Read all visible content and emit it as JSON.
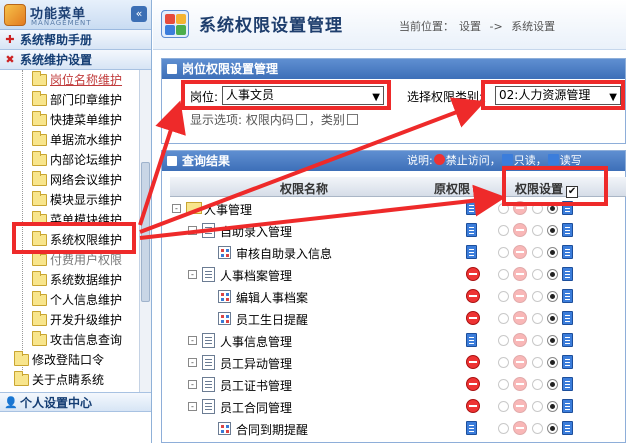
{
  "sidebar": {
    "title": "功能菜单",
    "subtitle": "MANAGEMENT",
    "collapse_label": "«",
    "section_help": "系统帮助手册",
    "section_maint": "系统维护设置",
    "items": [
      {
        "label": "岗位名称维护",
        "indent": 1,
        "state": "active"
      },
      {
        "label": "部门印章维护",
        "indent": 1,
        "state": "normal"
      },
      {
        "label": "快捷菜单维护",
        "indent": 1,
        "state": "normal"
      },
      {
        "label": "单据流水维护",
        "indent": 1,
        "state": "normal"
      },
      {
        "label": "内部论坛维护",
        "indent": 1,
        "state": "normal"
      },
      {
        "label": "网络会议维护",
        "indent": 1,
        "state": "normal"
      },
      {
        "label": "模块显示维护",
        "indent": 1,
        "state": "normal"
      },
      {
        "label": "菜单模块维护",
        "indent": 1,
        "state": "normal"
      },
      {
        "label": "系统权限维护",
        "indent": 1,
        "state": "normal"
      },
      {
        "label": "付费用户权限",
        "indent": 1,
        "state": "dim"
      },
      {
        "label": "系统数据维护",
        "indent": 1,
        "state": "normal"
      },
      {
        "label": "个人信息维护",
        "indent": 1,
        "state": "normal"
      },
      {
        "label": "开发升级维护",
        "indent": 1,
        "state": "normal"
      },
      {
        "label": "攻击信息查询",
        "indent": 1,
        "state": "normal"
      },
      {
        "label": "修改登陆口令",
        "indent": 0,
        "state": "normal"
      },
      {
        "label": "关于点睛系统",
        "indent": 0,
        "state": "normal"
      }
    ],
    "section_personal": "个人设置中心"
  },
  "header": {
    "title": "系统权限设置管理",
    "crumb_prefix": "当前位置：",
    "crumb_1": "设置",
    "crumb_sep": "->",
    "crumb_2": "系统设置"
  },
  "post_panel": {
    "title": "岗位权限设置管理",
    "post_label": "岗位:",
    "post_value": "人事文员",
    "category_label": "选择权限类别:",
    "category_value": "02:人力资源管理",
    "display_label": "显示选项: 权限内码",
    "category_option": "，类别"
  },
  "results_panel": {
    "title": "查询结果",
    "legend_prefix": "说明:",
    "legend_deny": "禁止访问",
    "legend_read": "只读",
    "legend_write": "读写"
  },
  "table": {
    "col_name": "权限名称",
    "col_orig": "原权限",
    "col_set": "权限设置",
    "rows": [
      {
        "name": "人事管理",
        "level": 0,
        "icon": "folder",
        "orig": "read",
        "set": "read",
        "expander": "-"
      },
      {
        "name": "自助录入管理",
        "level": 1,
        "icon": "doc",
        "orig": "read",
        "set": "read",
        "expander": "-"
      },
      {
        "name": "审核自助录入信息",
        "level": 2,
        "icon": "grid",
        "orig": "read",
        "set": "read",
        "expander": ""
      },
      {
        "name": "人事档案管理",
        "level": 1,
        "icon": "doc",
        "orig": "deny",
        "set": "read",
        "expander": "-"
      },
      {
        "name": "编辑人事档案",
        "level": 2,
        "icon": "grid",
        "orig": "deny",
        "set": "read",
        "expander": ""
      },
      {
        "name": "员工生日提醒",
        "level": 2,
        "icon": "grid",
        "orig": "deny",
        "set": "read",
        "expander": ""
      },
      {
        "name": "人事信息管理",
        "level": 1,
        "icon": "doc",
        "orig": "read",
        "set": "read",
        "expander": "-"
      },
      {
        "name": "员工异动管理",
        "level": 1,
        "icon": "doc",
        "orig": "deny",
        "set": "read",
        "expander": "-"
      },
      {
        "name": "员工证书管理",
        "level": 1,
        "icon": "doc",
        "orig": "deny",
        "set": "read",
        "expander": "-"
      },
      {
        "name": "员工合同管理",
        "level": 1,
        "icon": "doc",
        "orig": "deny",
        "set": "read",
        "expander": "-"
      },
      {
        "name": "合同到期提醒",
        "level": 2,
        "icon": "grid",
        "orig": "read",
        "set": "read",
        "expander": ""
      }
    ]
  },
  "colors": {
    "accent_blue": "#3d6fb8",
    "highlight_red": "#ee2a2a"
  }
}
